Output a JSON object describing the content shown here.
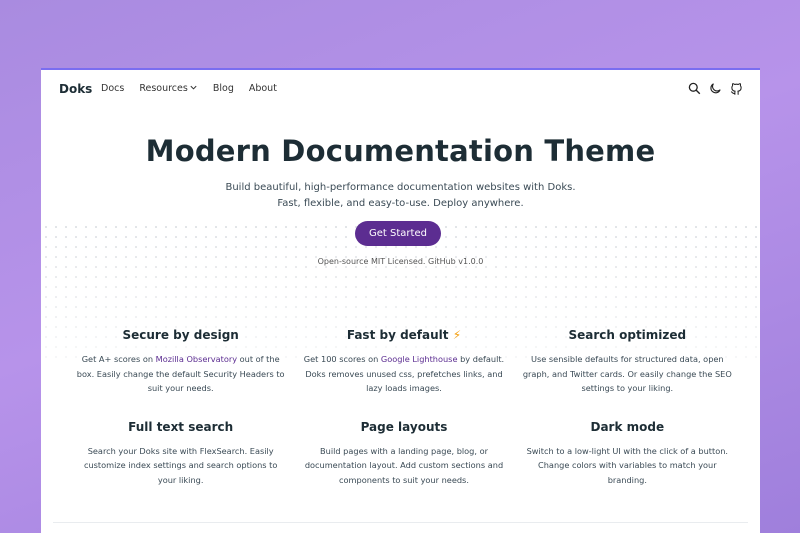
{
  "nav": {
    "brand": "Doks",
    "links": [
      "Docs",
      "Resources",
      "Blog",
      "About"
    ],
    "icons": [
      "search-icon",
      "moon-icon",
      "github-icon"
    ]
  },
  "hero": {
    "title": "Modern Documentation Theme",
    "subtitle_line1": "Build beautiful, high-performance documentation websites with Doks.",
    "subtitle_line2": "Fast, flexible, and easy-to-use. Deploy anywhere.",
    "cta_label": "Get Started",
    "license_text": "Open-source MIT Licensed. GitHub v1.0.0"
  },
  "features": [
    {
      "title": "Secure by design",
      "pre": "Get A+ scores on ",
      "link": "Mozilla Observatory",
      "post": " out of the box. Easily change the default Security Headers to suit your needs."
    },
    {
      "title": "Fast by default",
      "badge": "⚡",
      "pre": "Get 100 scores on ",
      "link": "Google Lighthouse",
      "post": " by default. Doks removes unused css, prefetches links, and lazy loads images."
    },
    {
      "title": "Search optimized",
      "pre": "Use sensible defaults for structured data, open graph, and Twitter cards. Or easily change the SEO settings to your liking.",
      "link": "",
      "post": ""
    },
    {
      "title": "Full text search",
      "pre": "Search your Doks site with FlexSearch. Easily customize index settings and search options to your liking.",
      "link": "",
      "post": ""
    },
    {
      "title": "Page layouts",
      "pre": "Build pages with a landing page, blog, or documentation layout. Add custom sections and components to suit your needs.",
      "link": "",
      "post": ""
    },
    {
      "title": "Dark mode",
      "pre": "Switch to a low-light UI with the click of a button. Change colors with variables to match your branding.",
      "link": "",
      "post": ""
    }
  ],
  "colors": {
    "primary": "#5c2d91",
    "accent_bolt": "#f59e0b",
    "text": "#1d2d35"
  }
}
